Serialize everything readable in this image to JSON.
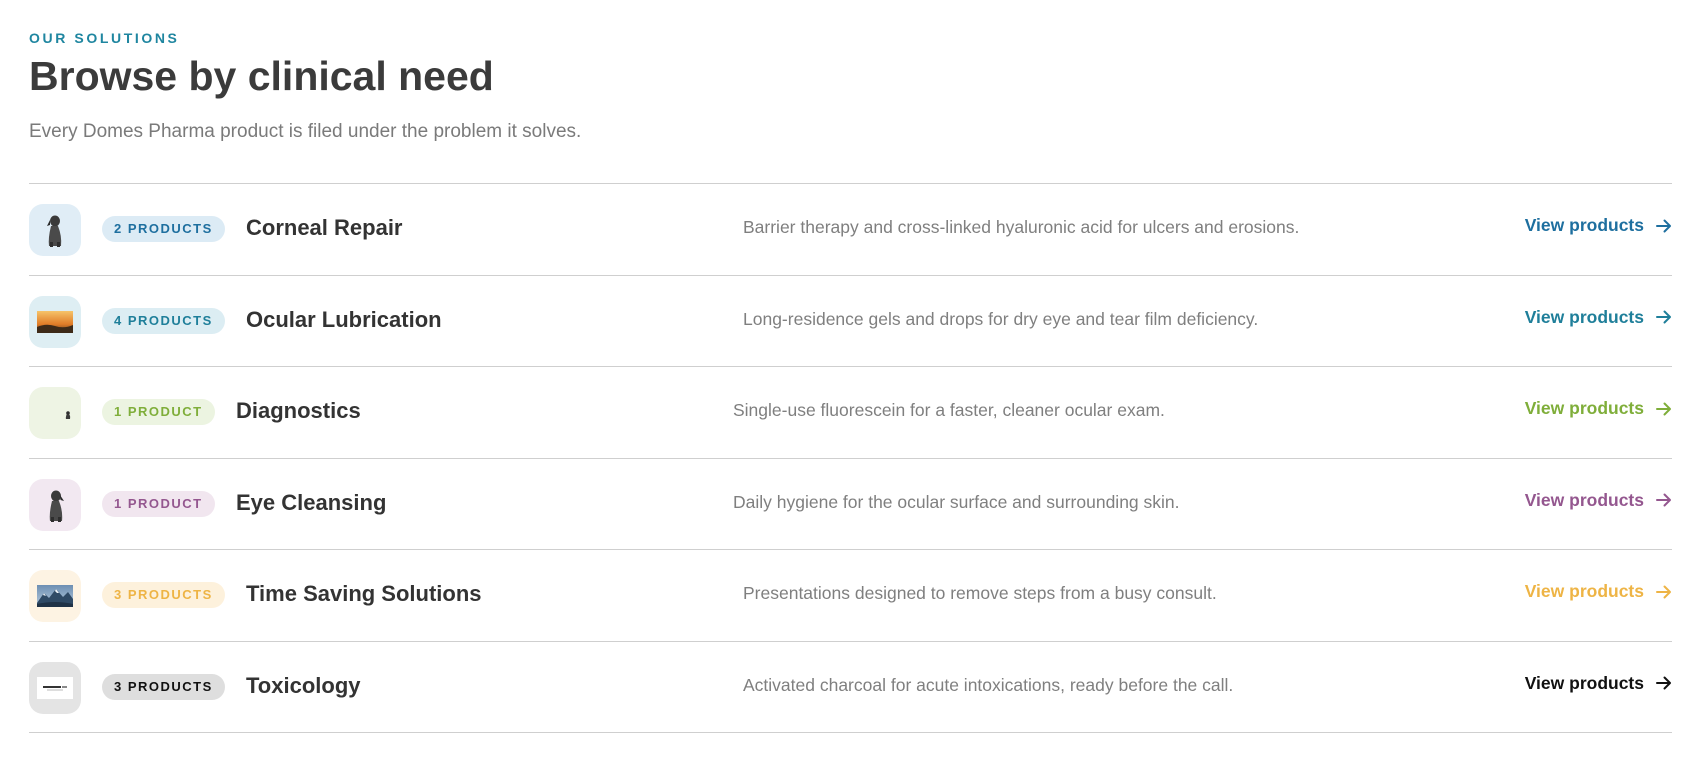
{
  "header": {
    "eyebrow": "OUR SOLUTIONS",
    "title": "Browse by clinical need",
    "subtitle": "Every Domes Pharma product is filed under the problem it solves."
  },
  "rows": [
    {
      "badge": "2 PRODUCTS",
      "name": "Corneal Repair",
      "description": "Barrier therapy and cross-linked hyaluronic acid for ulcers and erosions.",
      "link": "View products",
      "icon": "sitting-dog-image",
      "accent": "#1e6f9f",
      "badge_bg": "#dcebf5",
      "thumb_bg": "#e0edf6"
    },
    {
      "badge": "4 PRODUCTS",
      "name": "Ocular Lubrication",
      "description": "Long-residence gels and drops for dry eye and tear film deficiency.",
      "link": "View products",
      "icon": "sunset-landscape-image",
      "accent": "#1f7f9a",
      "badge_bg": "#dcedf3",
      "thumb_bg": "#deeef3"
    },
    {
      "badge": "1 PRODUCT",
      "name": "Diagnostics",
      "description": "Single-use fluorescein for a faster, cleaner ocular exam.",
      "link": "View products",
      "icon": "small-dog-image",
      "accent": "#7fae3a",
      "badge_bg": "#ecf4e1",
      "thumb_bg": "#eef4e4"
    },
    {
      "badge": "1 PRODUCT",
      "name": "Eye Cleansing",
      "description": "Daily hygiene for the ocular surface and surrounding skin.",
      "link": "View products",
      "icon": "sitting-dog-image",
      "accent": "#94578f",
      "badge_bg": "#f1e6ef",
      "thumb_bg": "#f2e8f1"
    },
    {
      "badge": "3 PRODUCTS",
      "name": "Time Saving Solutions",
      "description": "Presentations designed to remove steps from a busy consult.",
      "link": "View products",
      "icon": "mountain-landscape-image",
      "accent": "#eeb445",
      "badge_bg": "#fdf1dc",
      "thumb_bg": "#fdf3e3"
    },
    {
      "badge": "3 PRODUCTS",
      "name": "Toxicology",
      "description": "Activated charcoal for acute intoxications, ready before the call.",
      "link": "View products",
      "icon": "product-label-image",
      "accent": "#111111",
      "badge_bg": "#dedede",
      "thumb_bg": "#e4e4e4"
    }
  ]
}
